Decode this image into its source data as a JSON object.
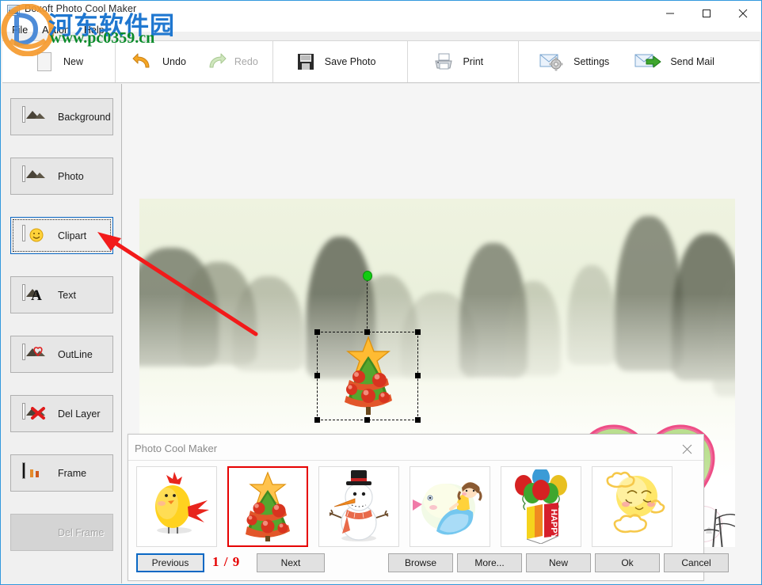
{
  "window": {
    "title": "Boxoft Photo Cool Maker",
    "icon": "photo-icon",
    "controls": {
      "minimize": "minimize-icon",
      "maximize": "maximize-icon",
      "close": "close-icon"
    }
  },
  "menu": {
    "items": [
      "File",
      "Action",
      "Help"
    ]
  },
  "toolbar": {
    "groups": [
      {
        "buttons": [
          {
            "label": "New",
            "icon": "new-page-icon",
            "enabled": true
          }
        ]
      },
      {
        "buttons": [
          {
            "label": "Undo",
            "icon": "undo-arrow-icon",
            "enabled": true
          },
          {
            "label": "Redo",
            "icon": "redo-arrow-icon",
            "enabled": false
          }
        ]
      },
      {
        "buttons": [
          {
            "label": "Save Photo",
            "icon": "floppy-disk-icon",
            "enabled": true
          }
        ]
      },
      {
        "buttons": [
          {
            "label": "Print",
            "icon": "printer-icon",
            "enabled": true
          }
        ]
      },
      {
        "buttons": [
          {
            "label": "Settings",
            "icon": "envelope-gear-icon",
            "enabled": true
          },
          {
            "label": "Send Mail",
            "icon": "envelope-arrow-icon",
            "enabled": true
          }
        ]
      }
    ]
  },
  "sidebar": {
    "items": [
      {
        "label": "Background",
        "icon": "landscape-thumb-icon",
        "state": "normal"
      },
      {
        "label": "Photo",
        "icon": "landscape-thumb-icon",
        "state": "normal"
      },
      {
        "label": "Clipart",
        "icon": "smiley-thumb-icon",
        "state": "selected"
      },
      {
        "label": "Text",
        "icon": "letter-a-thumb-icon",
        "state": "normal"
      },
      {
        "label": "OutLine",
        "icon": "outline-thumb-icon",
        "state": "normal"
      },
      {
        "label": "Del Layer",
        "icon": "delete-layer-icon",
        "state": "normal"
      },
      {
        "label": "Frame",
        "icon": "frame-thumb-icon",
        "state": "normal"
      },
      {
        "label": "Del Frame",
        "icon": "del-frame-icon",
        "state": "disabled"
      }
    ]
  },
  "canvas": {
    "description": "Chinese ink-wash landscape photo with misty mountains, flying cranes, a small boat and a pink heart photo frame",
    "selected_object": "christmas-tree-clipart",
    "rotation_handle": "rotate-handle"
  },
  "annotation": {
    "arrow": "red-pointer-arrow",
    "points_to": "Clipart"
  },
  "clipart_panel": {
    "title": "Photo Cool Maker",
    "close_icon": "close-icon",
    "page_indicator": "1 / 9",
    "current_page": 1,
    "total_pages": 9,
    "thumbnails": [
      {
        "name": "yellow-chick-clipart",
        "selected": false
      },
      {
        "name": "christmas-tree-clipart",
        "selected": true
      },
      {
        "name": "snowman-clipart",
        "selected": false
      },
      {
        "name": "girl-on-bird-clipart",
        "selected": false
      },
      {
        "name": "happy-balloons-clipart",
        "selected": false
      },
      {
        "name": "moon-face-clipart",
        "selected": false
      }
    ],
    "buttons": [
      {
        "label": "Previous",
        "focused": true
      },
      {
        "label": "Next",
        "focused": false
      },
      {
        "label": "Browse",
        "focused": false
      },
      {
        "label": "More...",
        "focused": false
      },
      {
        "label": "New",
        "focused": false
      },
      {
        "label": "Ok",
        "focused": false
      },
      {
        "label": "Cancel",
        "focused": false
      }
    ]
  },
  "watermark": {
    "chinese": "河东软件园",
    "url": "www.pc0359.cn",
    "logo": "circular-orange-logo"
  },
  "colors": {
    "accent_blue": "#0a68c4",
    "selection_red": "#e60000",
    "annotation_red": "#f21a1a",
    "watermark_blue": "#1f77d0",
    "watermark_green": "#0a8b2a",
    "toolbar_bg": "#ffffff",
    "sidebar_bg": "#f0f0f0"
  }
}
